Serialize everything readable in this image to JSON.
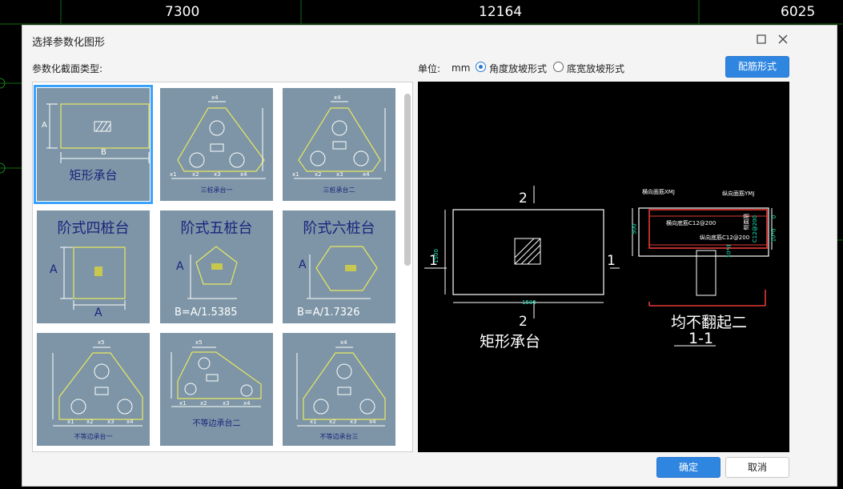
{
  "background": {
    "numbers": [
      "7300",
      "12164",
      "6025",
      "025"
    ]
  },
  "dialog": {
    "title": "选择参数化图形",
    "section_label": "参数化截面类型:",
    "unit_label": "单位:",
    "unit_value": "mm",
    "radio_angle": "角度放坡形式",
    "radio_bottom": "底宽放坡形式",
    "rebar_button": "配筋形式",
    "ok_button": "确定",
    "cancel_button": "取消"
  },
  "tiles": [
    {
      "caption": "矩形承台",
      "dimA": "A",
      "dimB": "B"
    },
    {
      "caption": "三桩承台一",
      "top": "x4",
      "bottom": [
        "x1",
        "x2",
        "x3",
        "x4"
      ],
      "side": [
        "y3",
        "y2",
        "y1"
      ]
    },
    {
      "caption": "三桩承台二",
      "top": "x4",
      "bottom": [
        "x1",
        "x2",
        "x3",
        "x4"
      ],
      "side": [
        "y3",
        "y2",
        "y1"
      ]
    },
    {
      "caption": "阶式四桩台",
      "dimA": "A",
      "dimB": "A"
    },
    {
      "caption": "阶式五桩台",
      "dimA": "A",
      "formula": "B=A/1.5385"
    },
    {
      "caption": "阶式六桩台",
      "dimA": "A",
      "formula": "B=A/1.7326"
    },
    {
      "caption": "不等边承台一",
      "top": "x5",
      "bottom": [
        "x1",
        "x2",
        "x3",
        "x4"
      ],
      "side": [
        "y4",
        "y3",
        "y2",
        "y1"
      ]
    },
    {
      "caption": "不等边承台二",
      "top": "x5",
      "bottom": [
        "x1",
        "x2",
        "x3",
        "x4"
      ],
      "side": [
        "y4",
        "y3",
        "y2",
        "y1"
      ]
    },
    {
      "caption": "不等边承台三",
      "top": "x4",
      "bottom": [
        "x1",
        "x2",
        "x3",
        "x4"
      ],
      "side": [
        "y4",
        "y3",
        "y2",
        "y1"
      ]
    }
  ],
  "preview": {
    "plan_title": "矩形承台",
    "section_label": "2",
    "left_label": "1",
    "right_label": "1",
    "bottom_label": "2",
    "dim_width": "1500",
    "dim_height": "1500",
    "sec_top_horiz": "横向面筋XMJ",
    "sec_top_vert": "纵向面筋YMJ",
    "sec_bottom_horiz": "横向底筋C12@200",
    "sec_bottom_vert": "纵向底筋C12@200",
    "sec_side": "侧面筋",
    "sec_side_val": "C12@200",
    "sec_height": "500",
    "sec_zero": "0",
    "sec_right": "10*d",
    "sec_right2": "10*d",
    "sec_note": "均不翻起二",
    "sec_name": "1-1"
  }
}
